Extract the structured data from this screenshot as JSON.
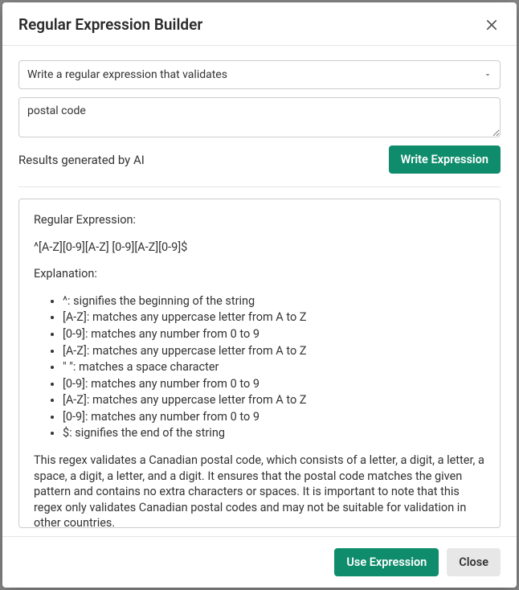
{
  "modal": {
    "title": "Regular Expression Builder"
  },
  "form": {
    "select_label": "Write a regular expression that validates",
    "textarea_value": "postal code",
    "status_text": "Results generated by AI",
    "write_button": "Write Expression"
  },
  "results": {
    "heading_regex": "Regular Expression:",
    "regex_value": "^[A-Z][0-9][A-Z] [0-9][A-Z][0-9]$",
    "heading_explanation": "Explanation:",
    "items": [
      "^: signifies the beginning of the string",
      "[A-Z]: matches any uppercase letter from A to Z",
      "[0-9]: matches any number from 0 to 9",
      "[A-Z]: matches any uppercase letter from A to Z",
      "\" \": matches a space character",
      "[0-9]: matches any number from 0 to 9",
      "[A-Z]: matches any uppercase letter from A to Z",
      "[0-9]: matches any number from 0 to 9",
      "$: signifies the end of the string"
    ],
    "summary": "This regex validates a Canadian postal code, which consists of a letter, a digit, a letter, a space, a digit, a letter, and a digit. It ensures that the postal code matches the given pattern and contains no extra characters or spaces. It is important to note that this regex only validates Canadian postal codes and may not be suitable for validation in other countries."
  },
  "footer": {
    "use_button": "Use Expression",
    "close_button": "Close"
  }
}
